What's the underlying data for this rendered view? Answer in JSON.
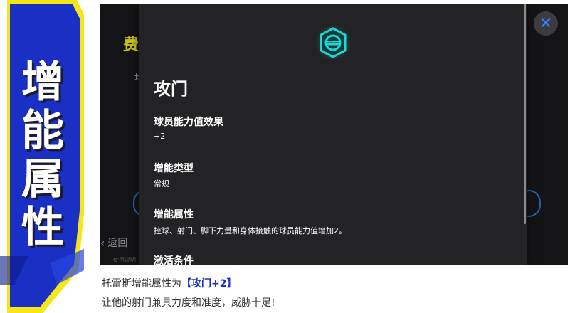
{
  "banner": {
    "title": "增能属性"
  },
  "background_screen": {
    "fee_label": "费",
    "partial_text": "均",
    "back_label": "返回",
    "bottom_text": "使用说明"
  },
  "panel": {
    "title": "攻门",
    "sections": [
      {
        "heading": "球员能力值效果",
        "value": "+2"
      },
      {
        "heading": "增能类型",
        "value": "常规"
      },
      {
        "heading": "增能属性",
        "value": "控球、射门、脚下力量和身体接触的球员能力值增加2。"
      },
      {
        "heading": "激活条件",
        "value": ""
      }
    ]
  },
  "close_button": {
    "symbol": "✕"
  },
  "caption": {
    "prefix": "托雷斯增能属性为",
    "highlight": "【攻门+2】",
    "line2": "让他的射门兼具力度和准度，威胁十足!"
  },
  "colors": {
    "banner_blue": "#1a2fc4",
    "banner_yellow": "#f5e61a",
    "accent_cyan": "#1fd6d6",
    "close_blue": "#2e86ff"
  }
}
